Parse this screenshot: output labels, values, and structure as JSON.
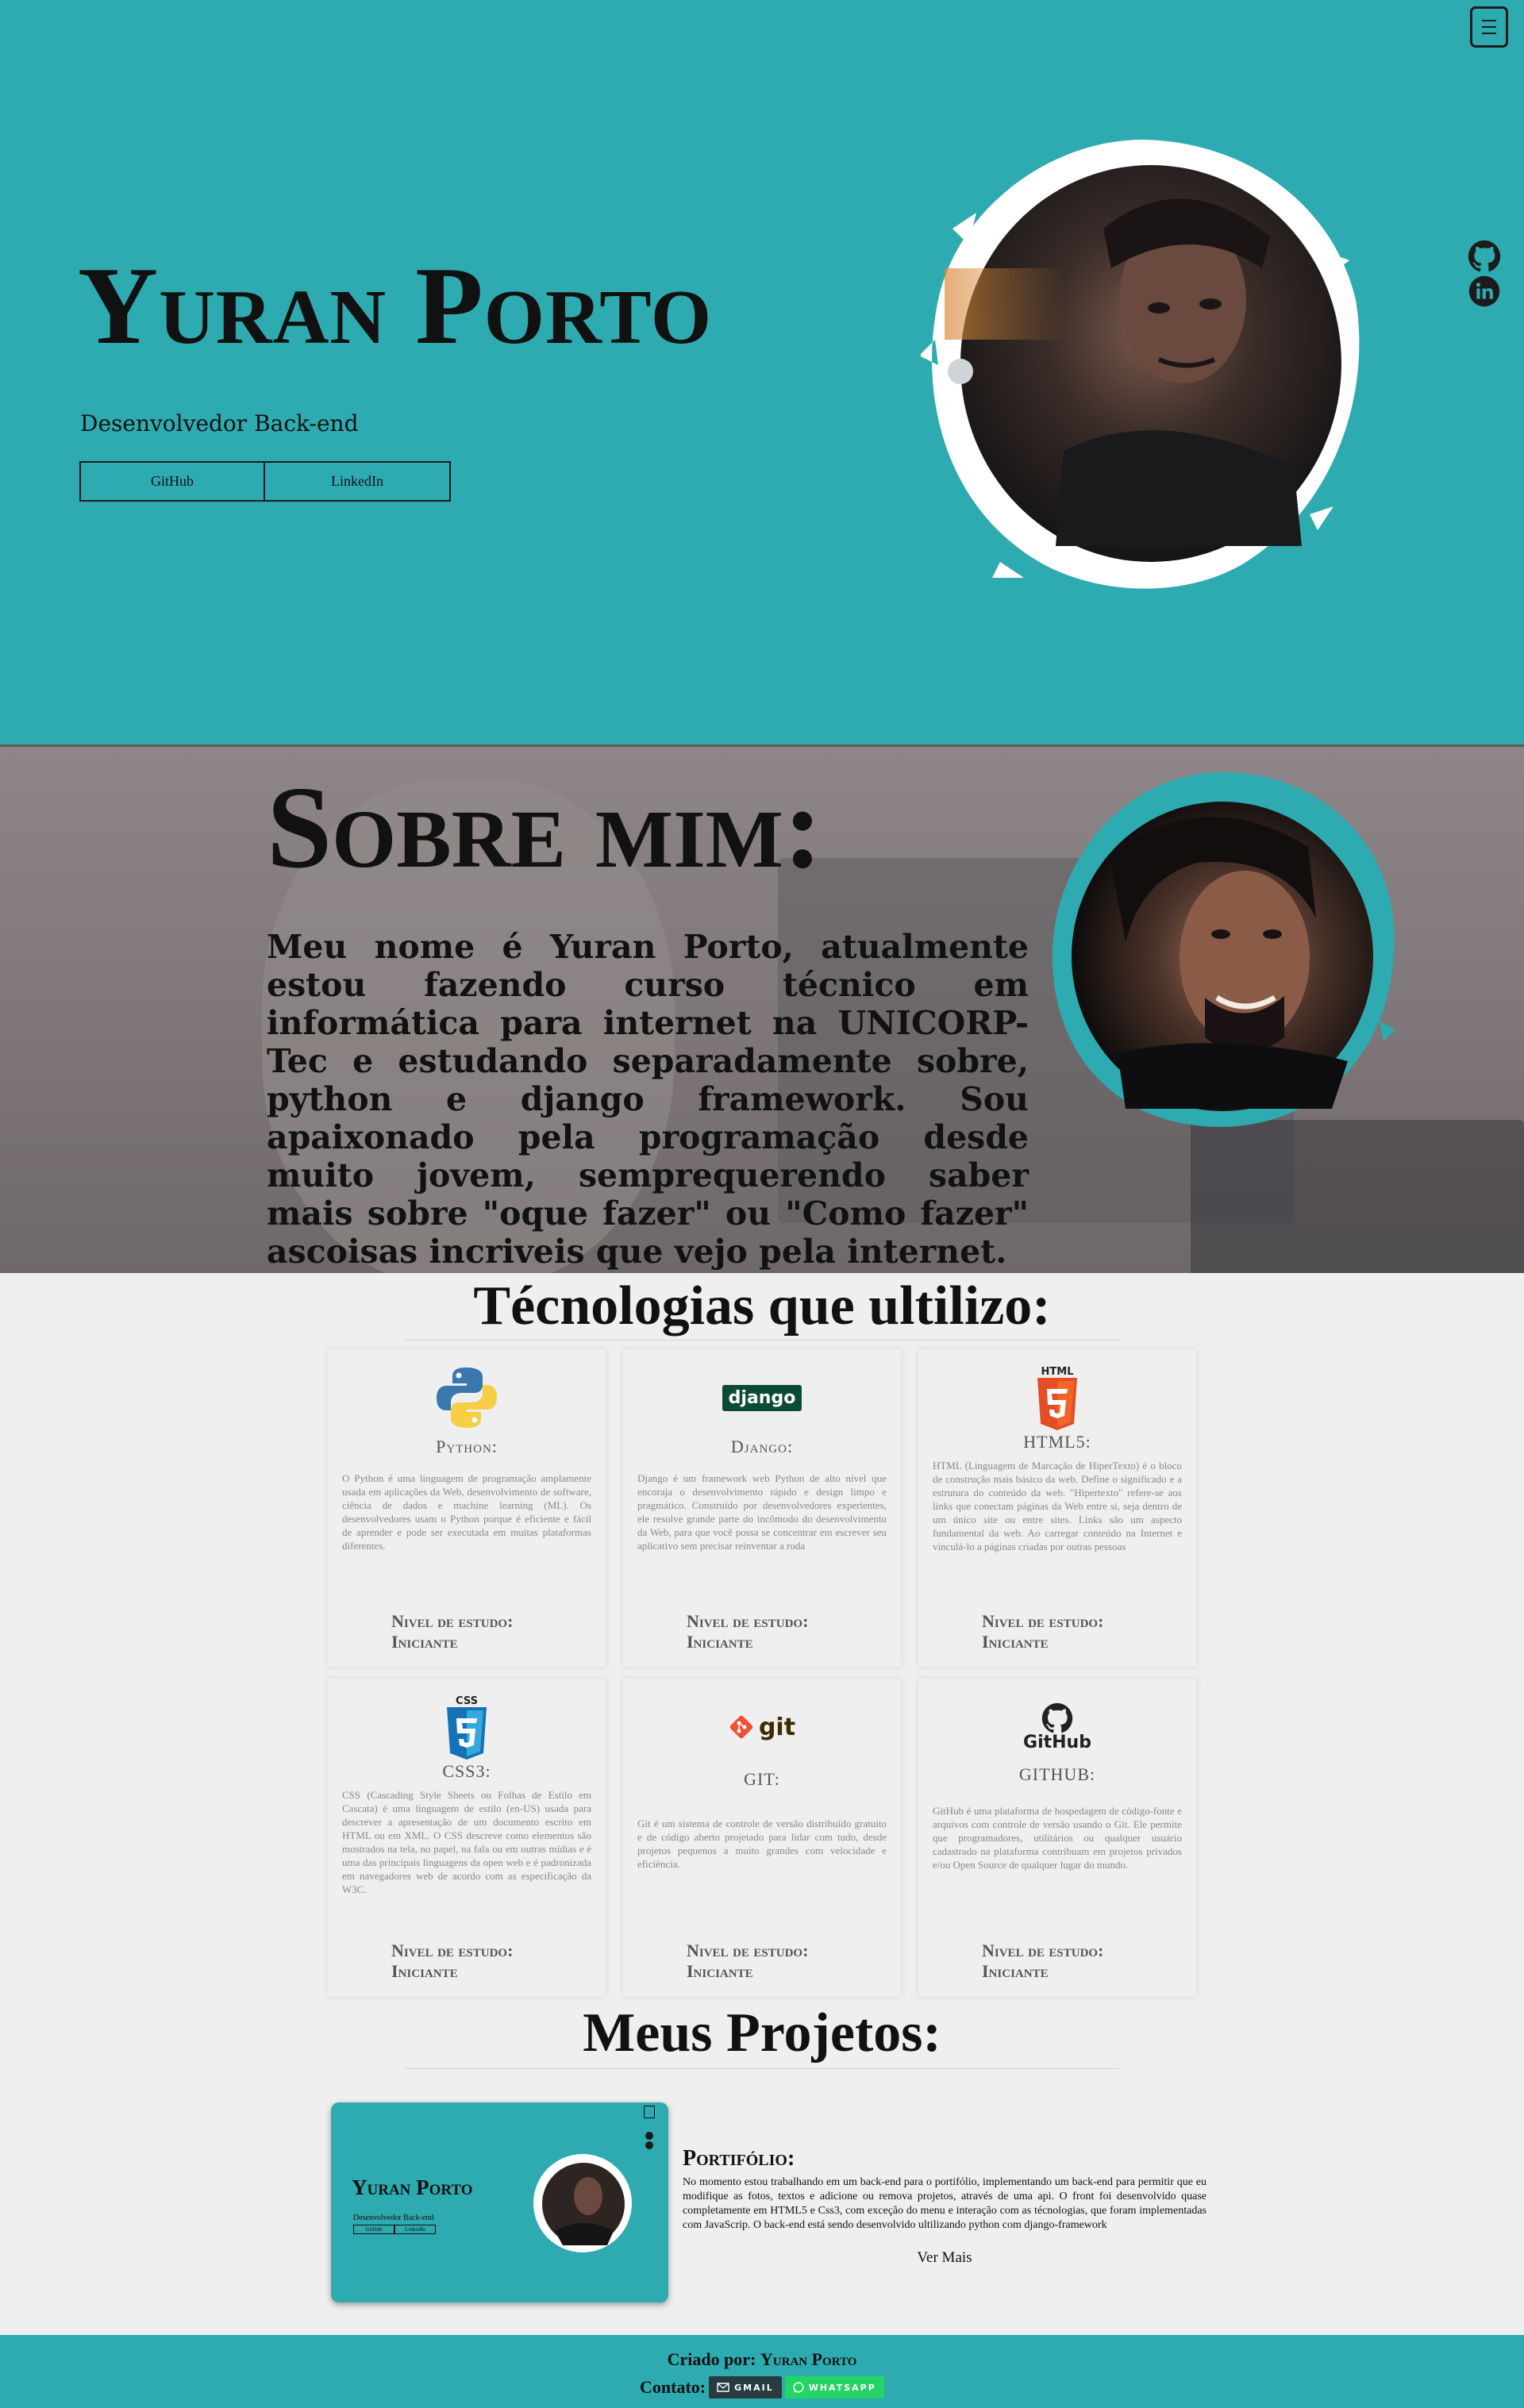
{
  "hero": {
    "name": "Yuran Porto",
    "role": "Desenvolvedor Back-end",
    "buttons": [
      "GitHub",
      "LinkedIn"
    ],
    "menu_icon": "hamburger-icon",
    "social_icons": [
      "github-icon",
      "linkedin-icon"
    ],
    "accent_color": "#2eaab1"
  },
  "about": {
    "title": "Sobre mim:",
    "text": "Meu nome é Yuran Porto, atualmente estou fazendo curso técnico em informática para internet na UNICORP-Tec e estudando separadamente sobre, python e django framework. Sou apaixonado pela programação desde muito jovem, semprequerendo saber mais sobre \"oque fazer\" ou \"Como fazer\" ascoisas incriveis que vejo pela internet."
  },
  "tech": {
    "title": "Técnologias que ultilizo:",
    "level_label": "Nivel de estudo:",
    "cards": [
      {
        "logo": "python-logo",
        "title": "Python:",
        "desc": "O Python é uma linguagem de programação amplamente usada em aplicações da Web, desenvolvimento de software, ciência de dados e machine learning (ML). Os desenvolvedores usam o Python porque é eficiente e fácil de aprender e pode ser executada em muitas plataformas diferentes.",
        "level": "Iniciante"
      },
      {
        "logo": "django-logo",
        "logo_text": "django",
        "title": "Django:",
        "desc": "Django é um framework web Python de alto nível que encoraja o desenvolvimento rápido e design limpo e pragmático. Construído por desenvolvedores experientes, ele resolve grande parte do incômodo do desenvolvimento da Web, para que você possa se concentrar em escrever seu aplicativo sem precisar reinventar a roda",
        "level": "Iniciante"
      },
      {
        "logo": "html5-logo",
        "logo_text": "HTML",
        "title": "HTML5:",
        "desc": "HTML (Linguagem de Marcação de HiperTexto) é o bloco de construção mais básico da web. Define o significado e a estrutura do conteúdo da web. \"Hipertexto\" refere-se aos links que conectam páginas da Web entre si, seja dentro de um único site ou entre sites. Links são um aspecto fundamental da web. Ao carregar conteúdo na Internet e vinculá-lo a páginas criadas por outras pessoas",
        "level": "Iniciante"
      },
      {
        "logo": "css3-logo",
        "logo_text": "CSS",
        "title": "CSS3:",
        "desc": "CSS (Cascading Style Sheets ou Folhas de Estilo em Cascata) é uma linguagem de estilo (en-US) usada para descrever a apresentação de um documento escrito em HTML ou em XML. O CSS descreve como elementos são mostrados na tela, no papel, na fala ou em outras mídias e é uma das principais linguagens da open web e é padronizada em navegadores web de acordo com as especificação da W3C.",
        "level": "Iniciante"
      },
      {
        "logo": "git-logo",
        "logo_text": "git",
        "title": "GIT:",
        "desc": "Git é um sistema de controle de versão distribuído gratuito e de código aberto projetado para lidar com tudo, desde projetos pequenos a muito grandes com velocidade e eficiência.",
        "level": "Iniciante"
      },
      {
        "logo": "github-logo",
        "logo_text": "GitHub",
        "title": "GITHUB:",
        "desc": "GitHub é uma plataforma de hospedagem de código-fonte e arquivos com controle de versão usando o Git. Ele permite que programadores, utilitários ou qualquer usuário cadastrado na plataforma contribuam em projetos privados e/ou Open Source de qualquer lugar do mundo.",
        "level": "Iniciante"
      }
    ]
  },
  "projects": {
    "title": "Meus Projetos:",
    "items": [
      {
        "title": "Portifólio:",
        "desc": "No momento estou trabalhando em um back-end para o portifólio, implementando um back-end para permitir que eu modifique as fotos, textos e adicione ou remova projetos, através de uma api. O front foi desenvolvido quase completamente em HTML5 e Css3, com exceção do menu e interação com as técnologias, que foram implementadas com JavaScrip. O back-end está sendo desenvolvido ultilizando python com django-framework",
        "more": "Ver Mais",
        "thumb": {
          "name": "Yuran Porto",
          "role": "Desenvolvedor Back-end",
          "buttons": [
            "GitHub",
            "LinkedIn"
          ]
        }
      }
    ]
  },
  "footer": {
    "credit_prefix": "Criado por:",
    "credit_name": "Yuran Porto",
    "contact_label": "Contato:",
    "gmail": "GMAIL",
    "whatsapp": "WHATSAPP"
  }
}
